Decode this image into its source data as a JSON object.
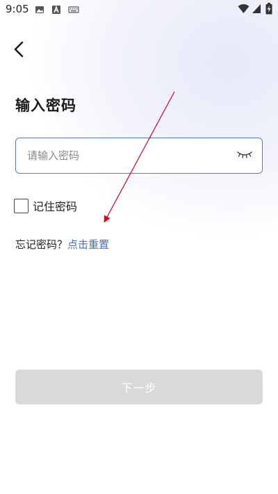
{
  "status_bar": {
    "time": "9:05",
    "icons": [
      "image-icon",
      "text-a-icon",
      "keyboard-icon",
      "wifi-icon",
      "signal-icon",
      "battery-charging-icon"
    ]
  },
  "header": {
    "back_icon": "chevron-left-icon"
  },
  "main": {
    "title": "输入密码",
    "password": {
      "placeholder": "请输入密码",
      "value": "",
      "toggle_icon": "eye-closed-icon"
    },
    "remember": {
      "label": "记住密码",
      "checked": false
    },
    "forgot": {
      "prompt": "忘记密码？",
      "link": "点击重置"
    },
    "next_button": {
      "label": "下一步",
      "enabled": false
    }
  },
  "colors": {
    "accent": "#3a6fd8",
    "input_border": "#4f79d6",
    "disabled_button": "#d9d9d9",
    "annotation": "#c8102e"
  }
}
